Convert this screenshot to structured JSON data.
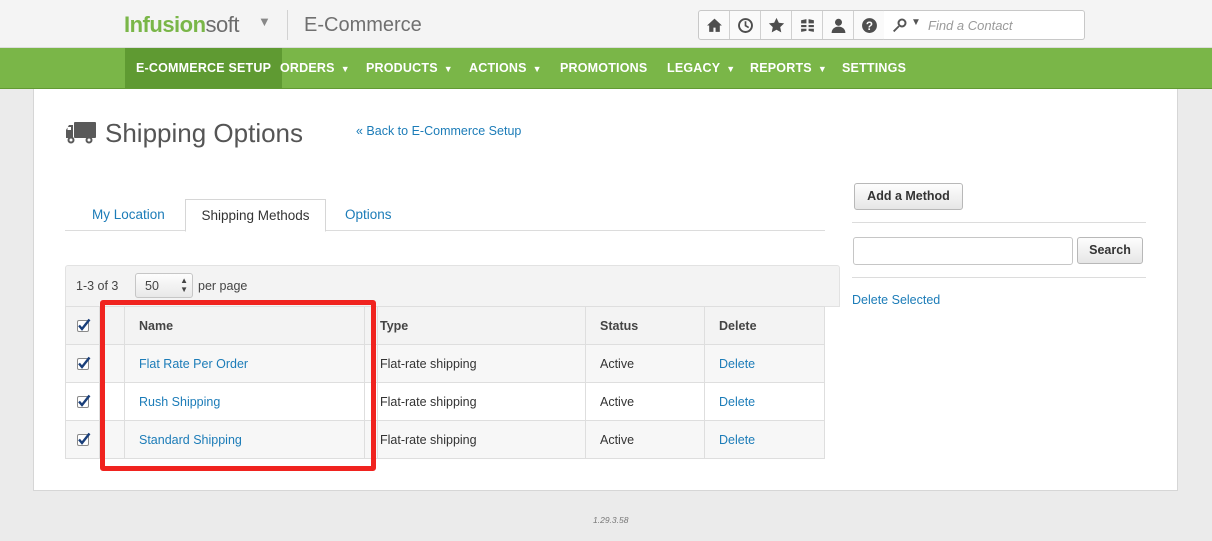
{
  "header": {
    "logo_part1": "Infusion",
    "logo_part2": "soft",
    "app_title": "E-Commerce",
    "icons": [
      "home-icon",
      "history-icon",
      "star-icon",
      "hashtag-icon",
      "contacts-icon",
      "help-icon"
    ],
    "contact_search_placeholder": "Find a Contact"
  },
  "nav": {
    "items": [
      {
        "label": "E-COMMERCE SETUP",
        "dropdown": false,
        "active": true
      },
      {
        "label": "ORDERS",
        "dropdown": true
      },
      {
        "label": "PRODUCTS",
        "dropdown": true
      },
      {
        "label": "ACTIONS",
        "dropdown": true
      },
      {
        "label": "PROMOTIONS",
        "dropdown": false
      },
      {
        "label": "LEGACY",
        "dropdown": true
      },
      {
        "label": "REPORTS",
        "dropdown": true
      },
      {
        "label": "SETTINGS",
        "dropdown": false
      }
    ],
    "caret": "▼",
    "accent_color": "#7ab648"
  },
  "page": {
    "title": "Shipping Options",
    "back_link": "« Back to E-Commerce Setup"
  },
  "tabs": [
    {
      "label": "My Location",
      "active": false
    },
    {
      "label": "Shipping Methods",
      "active": true
    },
    {
      "label": "Options",
      "active": false
    }
  ],
  "pager": {
    "count_text": "1-3 of 3",
    "per_page_value": "50",
    "per_page_label": "per page"
  },
  "table": {
    "columns": [
      "Name",
      "Type",
      "Status",
      "Delete"
    ],
    "rows": [
      {
        "checked": true,
        "name": "Flat Rate Per Order",
        "type": "Flat-rate shipping",
        "status": "Active",
        "delete": "Delete"
      },
      {
        "checked": true,
        "name": "Rush Shipping",
        "type": "Flat-rate shipping",
        "status": "Active",
        "delete": "Delete"
      },
      {
        "checked": true,
        "name": "Standard Shipping",
        "type": "Flat-rate shipping",
        "status": "Active",
        "delete": "Delete"
      }
    ]
  },
  "sidebar": {
    "add_method_label": "Add a Method",
    "search_value": "",
    "search_button_label": "Search",
    "delete_selected_label": "Delete Selected"
  },
  "footer": {
    "version": "1.29.3.58"
  },
  "highlight_color": "#f0231f"
}
